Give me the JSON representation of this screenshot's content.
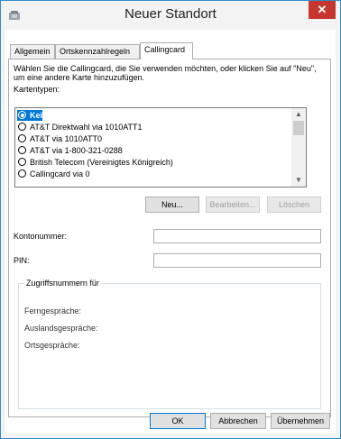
{
  "window": {
    "title": "Neuer Standort",
    "close_glyph": "✕",
    "accent": "#0078d7",
    "close_color": "#c7372f"
  },
  "tabs": [
    {
      "label": "Allgemein",
      "active": false
    },
    {
      "label": "Ortskennzahlregeln",
      "active": false
    },
    {
      "label": "Callingcard",
      "active": true
    }
  ],
  "callingcard": {
    "intro": "Wählen Sie die Callingcard, die Sie verwenden möchten, oder klicken Sie auf \"Neu\", um eine andere Karte hinzuzufügen.",
    "card_types_label": "Kartentypen:",
    "cards": [
      {
        "label": "Keine",
        "selected": true
      },
      {
        "label": "AT&T Direktwahl via 1010ATT1",
        "selected": false
      },
      {
        "label": "AT&T via 1010ATT0",
        "selected": false
      },
      {
        "label": "AT&T via 1-800-321-0288",
        "selected": false
      },
      {
        "label": "British Telecom (Vereinigtes Königreich)",
        "selected": false
      },
      {
        "label": "Callingcard via 0",
        "selected": false
      }
    ],
    "scroll_up_glyph": "▲",
    "scroll_down_glyph": "▼",
    "buttons": {
      "new": "Neu...",
      "edit": "Bearbeiten...",
      "delete": "Löschen"
    },
    "account_label": "Kontonummer:",
    "account_value": "",
    "pin_label": "PIN:",
    "pin_value": "",
    "access_group": {
      "title": "Zugriffsnummern für",
      "long_distance": "Ferngespräche:",
      "international": "Auslandsgespräche:",
      "local": "Ortsgespräche:"
    }
  },
  "footer": {
    "ok": "OK",
    "cancel": "Abbrechen",
    "apply": "Übernehmen"
  }
}
